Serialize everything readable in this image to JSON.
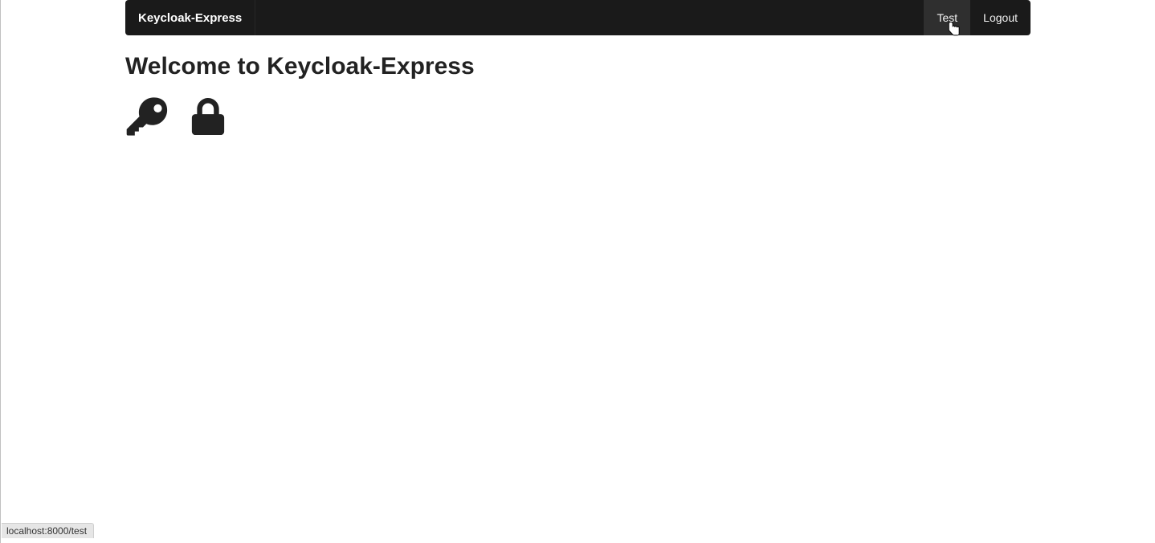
{
  "navbar": {
    "brand": "Keycloak-Express",
    "links": [
      {
        "label": "Test",
        "hovered": true
      },
      {
        "label": "Logout",
        "hovered": false
      }
    ]
  },
  "main": {
    "title": "Welcome to Keycloak-Express"
  },
  "icons": {
    "key": "key-icon",
    "lock": "lock-icon"
  },
  "status": {
    "url": "localhost:8000/test"
  }
}
